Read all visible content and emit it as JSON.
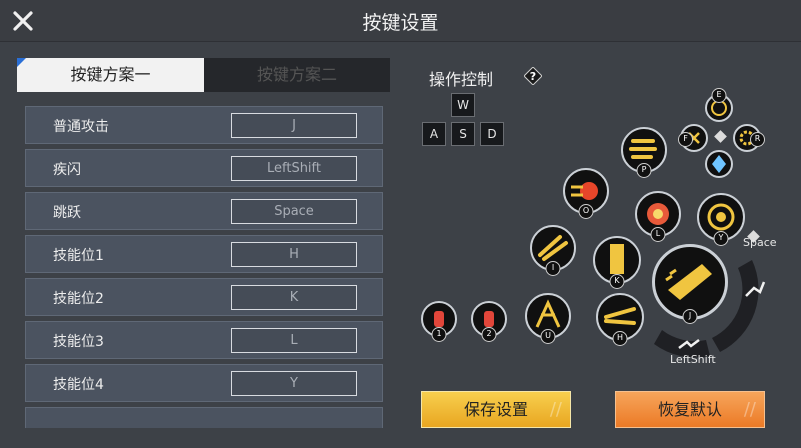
{
  "title": "按键设置",
  "tabs": [
    "按键方案一",
    "按键方案二"
  ],
  "bindings": [
    {
      "label": "普通攻击",
      "key": "J"
    },
    {
      "label": "疾闪",
      "key": "LeftShift"
    },
    {
      "label": "跳跃",
      "key": "Space"
    },
    {
      "label": "技能位1",
      "key": "H"
    },
    {
      "label": "技能位2",
      "key": "K"
    },
    {
      "label": "技能位3",
      "key": "L"
    },
    {
      "label": "技能位4",
      "key": "Y"
    }
  ],
  "operation": {
    "label": "操作控制",
    "help": "?"
  },
  "movement_keys": {
    "up": "W",
    "left": "A",
    "down": "S",
    "right": "D"
  },
  "skill_badges": {
    "e": "E",
    "f": "F",
    "r": "R",
    "p": "P",
    "o": "O",
    "l": "L",
    "y": "Y",
    "i": "I",
    "k": "K",
    "j": "J",
    "u": "U",
    "h": "H",
    "item1": "1",
    "item2": "2"
  },
  "space_label": "Space",
  "leftshift_label": "LeftShift",
  "buttons": {
    "save": "保存设置",
    "reset": "恢复默认"
  },
  "colors": {
    "accent_gold": "#f0c540",
    "accent_orange": "#ef8a35",
    "tab_marker": "#2a6fd6"
  }
}
